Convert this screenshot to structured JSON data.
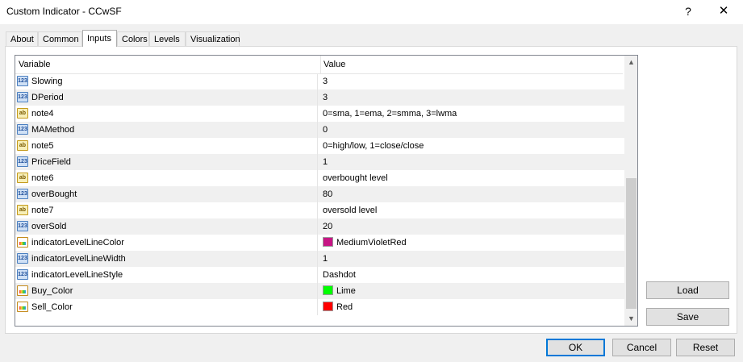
{
  "window": {
    "title": "Custom Indicator - CCwSF",
    "help_glyph": "?",
    "close_glyph": "✕"
  },
  "tabs": [
    {
      "label": "About"
    },
    {
      "label": "Common"
    },
    {
      "label": "Inputs",
      "active": true
    },
    {
      "label": "Colors"
    },
    {
      "label": "Levels"
    },
    {
      "label": "Visualization"
    }
  ],
  "grid": {
    "headers": {
      "variable": "Variable",
      "value": "Value"
    },
    "rows": [
      {
        "type": "int",
        "icon": "integer-type-icon",
        "name": "Slowing",
        "value": "3"
      },
      {
        "type": "int",
        "icon": "integer-type-icon",
        "name": "DPeriod",
        "value": "3"
      },
      {
        "type": "string",
        "icon": "string-type-icon",
        "name": "note4",
        "value": "0=sma, 1=ema, 2=smma, 3=lwma"
      },
      {
        "type": "int",
        "icon": "integer-type-icon",
        "name": "MAMethod",
        "value": "0"
      },
      {
        "type": "string",
        "icon": "string-type-icon",
        "name": "note5",
        "value": "0=high/low, 1=close/close"
      },
      {
        "type": "int",
        "icon": "integer-type-icon",
        "name": "PriceField",
        "value": "1"
      },
      {
        "type": "string",
        "icon": "string-type-icon",
        "name": "note6",
        "value": "overbought level"
      },
      {
        "type": "int",
        "icon": "integer-type-icon",
        "name": "overBought",
        "value": "80"
      },
      {
        "type": "string",
        "icon": "string-type-icon",
        "name": "note7",
        "value": "oversold level"
      },
      {
        "type": "int",
        "icon": "integer-type-icon",
        "name": "overSold",
        "value": "20"
      },
      {
        "type": "color",
        "icon": "color-type-icon",
        "name": "indicatorLevelLineColor",
        "value": "MediumVioletRed",
        "color": "#c71585"
      },
      {
        "type": "int",
        "icon": "integer-type-icon",
        "name": "indicatorLevelLineWidth",
        "value": "1"
      },
      {
        "type": "int",
        "icon": "integer-type-icon",
        "name": "indicatorLevelLineStyle",
        "value": "Dashdot"
      },
      {
        "type": "color",
        "icon": "color-type-icon",
        "name": "Buy_Color",
        "value": "Lime",
        "color": "#00ff00"
      },
      {
        "type": "color",
        "icon": "color-type-icon",
        "name": "Sell_Color",
        "value": "Red",
        "color": "#ff0000"
      }
    ]
  },
  "icons": {
    "integer_glyph": "123",
    "string_glyph": "ab",
    "scroll_up": "▲",
    "scroll_down": "▼"
  },
  "side_buttons": {
    "load": "Load",
    "save": "Save"
  },
  "footer_buttons": {
    "ok": "OK",
    "cancel": "Cancel",
    "reset": "Reset"
  },
  "colors": {
    "accent": "#0078d7",
    "alt_row": "#f0f0f0"
  }
}
